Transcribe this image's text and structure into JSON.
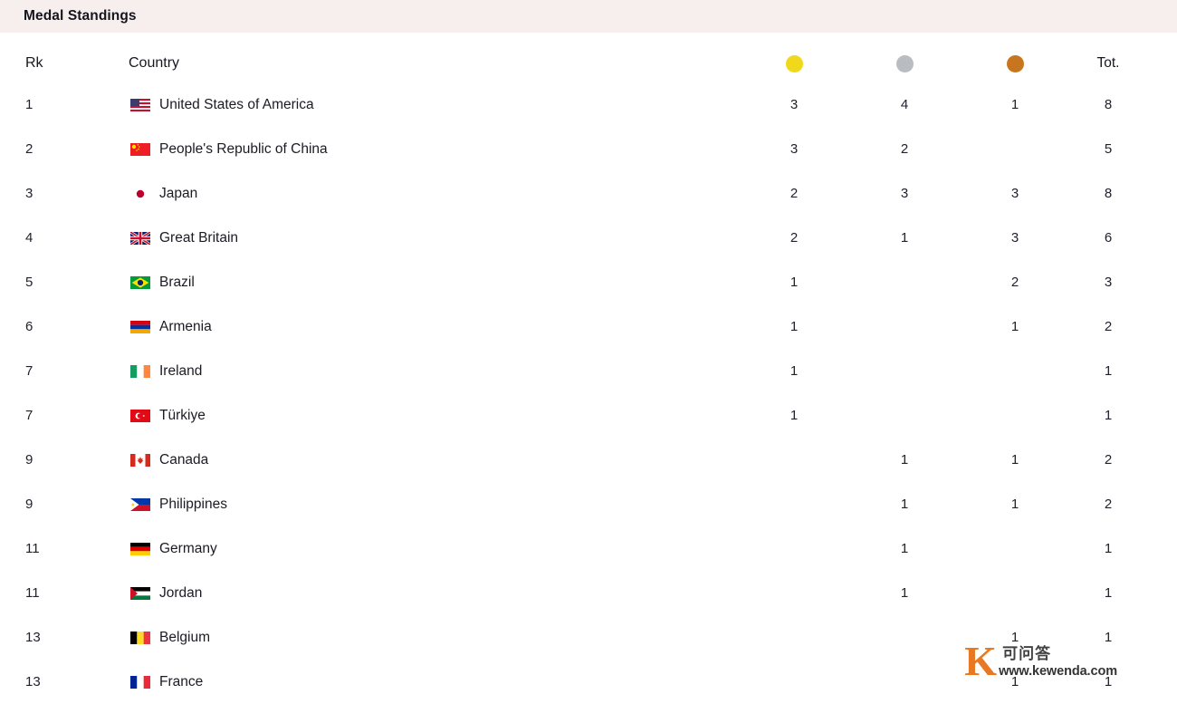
{
  "header": {
    "title": "Medal Standings",
    "bar_color": "#f7eeee"
  },
  "table": {
    "columns": {
      "rank": "Rk",
      "country": "Country",
      "gold": "gold-medal-icon",
      "silver": "silver-medal-icon",
      "bronze": "bronze-medal-icon",
      "total": "Tot."
    },
    "medal_colors": {
      "gold": "#f0d91a",
      "silver": "#b9bcc0",
      "bronze": "#c8761e"
    },
    "rows": [
      {
        "rank": "1",
        "flag": "flag-usa",
        "country": "United States of America",
        "gold": "3",
        "silver": "4",
        "bronze": "1",
        "total": "8"
      },
      {
        "rank": "2",
        "flag": "flag-china",
        "country": "People's Republic of China",
        "gold": "3",
        "silver": "2",
        "bronze": "",
        "total": "5"
      },
      {
        "rank": "3",
        "flag": "flag-japan",
        "country": "Japan",
        "gold": "2",
        "silver": "3",
        "bronze": "3",
        "total": "8"
      },
      {
        "rank": "4",
        "flag": "flag-gb",
        "country": "Great Britain",
        "gold": "2",
        "silver": "1",
        "bronze": "3",
        "total": "6"
      },
      {
        "rank": "5",
        "flag": "flag-brazil",
        "country": "Brazil",
        "gold": "1",
        "silver": "",
        "bronze": "2",
        "total": "3"
      },
      {
        "rank": "6",
        "flag": "flag-armenia",
        "country": "Armenia",
        "gold": "1",
        "silver": "",
        "bronze": "1",
        "total": "2"
      },
      {
        "rank": "7",
        "flag": "flag-ireland",
        "country": "Ireland",
        "gold": "1",
        "silver": "",
        "bronze": "",
        "total": "1"
      },
      {
        "rank": "7",
        "flag": "flag-turkiye",
        "country": "Türkiye",
        "gold": "1",
        "silver": "",
        "bronze": "",
        "total": "1"
      },
      {
        "rank": "9",
        "flag": "flag-canada",
        "country": "Canada",
        "gold": "",
        "silver": "1",
        "bronze": "1",
        "total": "2"
      },
      {
        "rank": "9",
        "flag": "flag-philippines",
        "country": "Philippines",
        "gold": "",
        "silver": "1",
        "bronze": "1",
        "total": "2"
      },
      {
        "rank": "11",
        "flag": "flag-germany",
        "country": "Germany",
        "gold": "",
        "silver": "1",
        "bronze": "",
        "total": "1"
      },
      {
        "rank": "11",
        "flag": "flag-jordan",
        "country": "Jordan",
        "gold": "",
        "silver": "1",
        "bronze": "",
        "total": "1"
      },
      {
        "rank": "13",
        "flag": "flag-belgium",
        "country": "Belgium",
        "gold": "",
        "silver": "",
        "bronze": "1",
        "total": "1"
      },
      {
        "rank": "13",
        "flag": "flag-france",
        "country": "France",
        "gold": "",
        "silver": "",
        "bronze": "1",
        "total": "1"
      }
    ]
  },
  "watermark": {
    "letter": "K",
    "cn_text": "可问答",
    "url": "www.kewenda.com",
    "accent_color": "#e8741a"
  }
}
